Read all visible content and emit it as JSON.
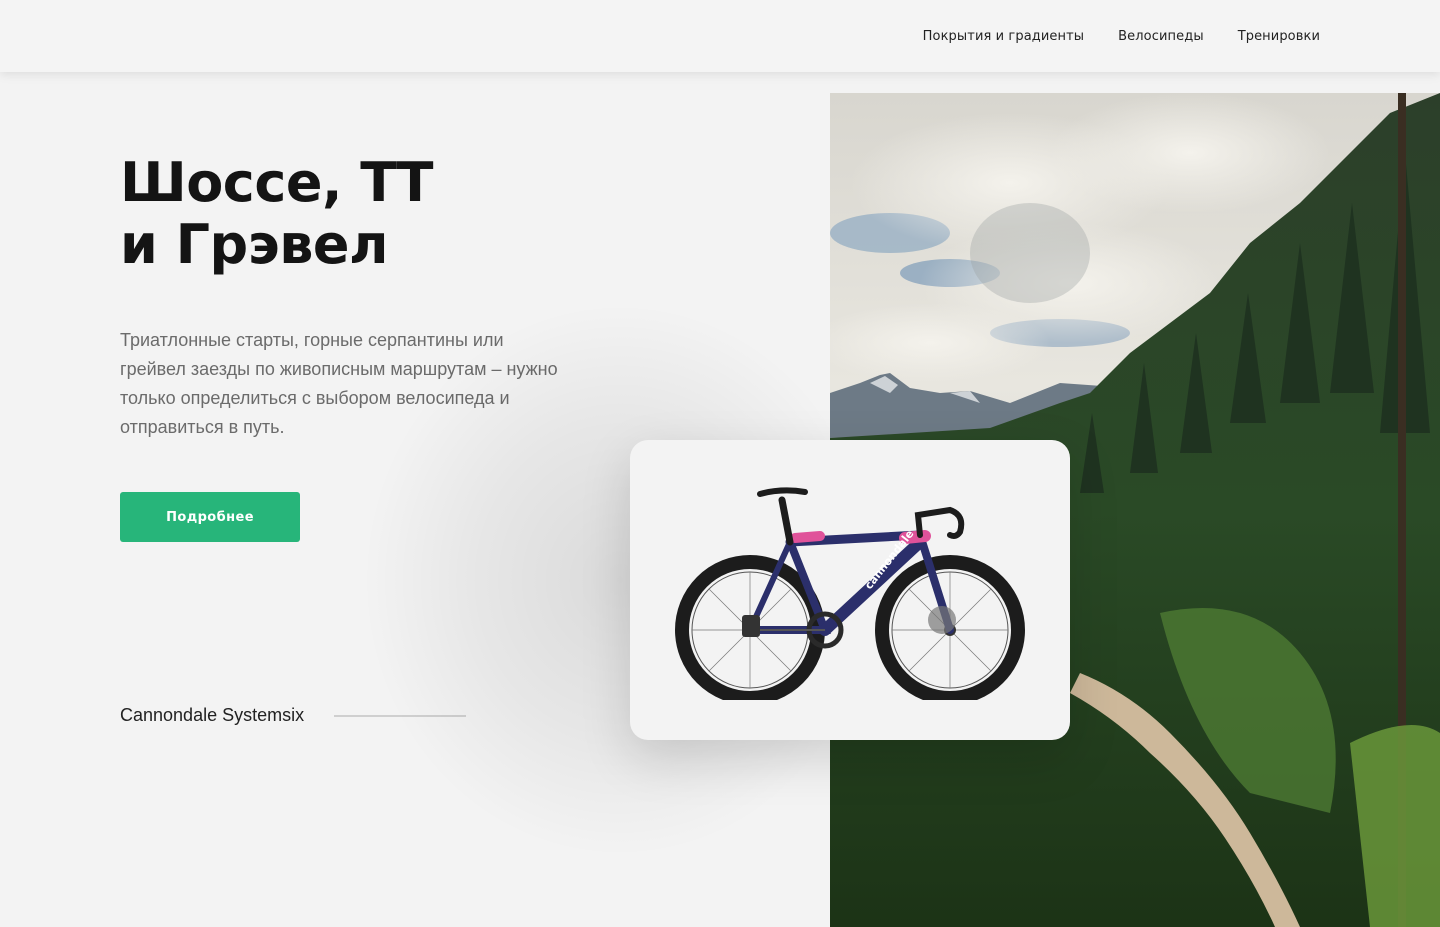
{
  "nav": {
    "items": [
      "Покрытия и градиенты",
      "Велосипеды",
      "Тренировки"
    ]
  },
  "hero": {
    "title": "Шоссе, ТТ\nи Грэвел",
    "description": "Триатлонные старты, горные серпантины или грейвел заезды по живописным маршрутам – нужно только определиться с выбором велосипеда и отправиться в путь.",
    "cta_label": "Подробнее",
    "model_name": "Cannondale Systemsix"
  },
  "product": {
    "frame_brand": "cannondale"
  },
  "colors": {
    "accent": "#27b57a",
    "background": "#f3f3f3",
    "frame": "#2b2f6b",
    "frame_pattern": "#e0529a"
  }
}
